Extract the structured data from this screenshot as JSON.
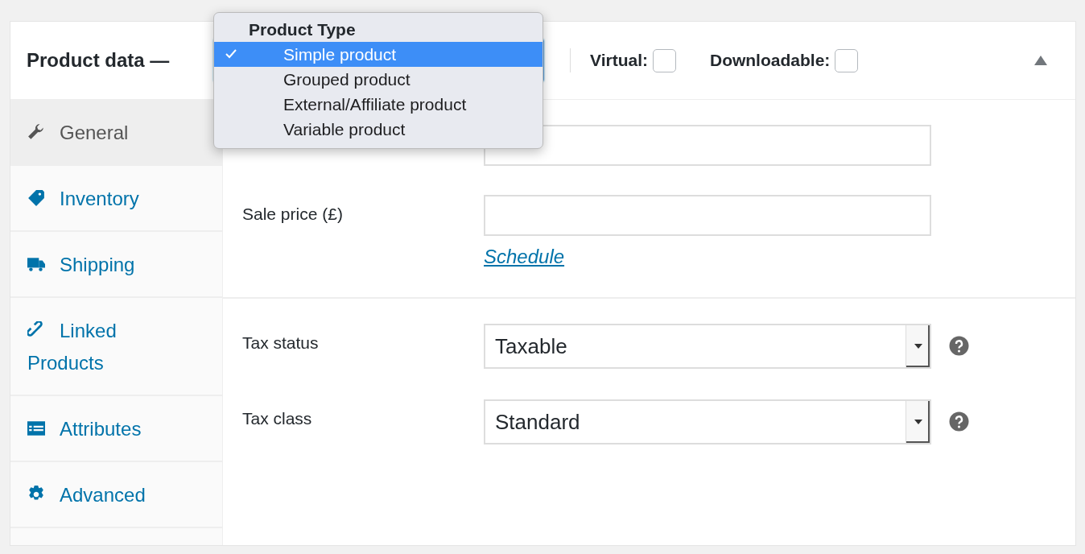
{
  "header": {
    "title": "Product data —",
    "checkboxes": [
      {
        "label": "Virtual:",
        "checked": false
      },
      {
        "label": "Downloadable:",
        "checked": false
      }
    ],
    "expanded": true
  },
  "product_type_menu": {
    "group_label": "Product Type",
    "options": [
      {
        "label": "Simple product",
        "selected": true
      },
      {
        "label": "Grouped product",
        "selected": false
      },
      {
        "label": "External/Affiliate product",
        "selected": false
      },
      {
        "label": "Variable product",
        "selected": false
      }
    ]
  },
  "tabs": [
    {
      "label": "General",
      "selected": true
    },
    {
      "label": "Inventory",
      "selected": false
    },
    {
      "label": "Shipping",
      "selected": false
    },
    {
      "label": "Linked Products",
      "selected": false
    },
    {
      "label": "Attributes",
      "selected": false
    },
    {
      "label": "Advanced",
      "selected": false
    }
  ],
  "pricing": {
    "fields": [
      {
        "label": "Sale price (£)"
      }
    ],
    "link": "Schedule"
  },
  "tax": {
    "selects": [
      {
        "label": "Tax status",
        "value": "Taxable"
      },
      {
        "label": "Tax class",
        "value": "Standard"
      }
    ]
  }
}
